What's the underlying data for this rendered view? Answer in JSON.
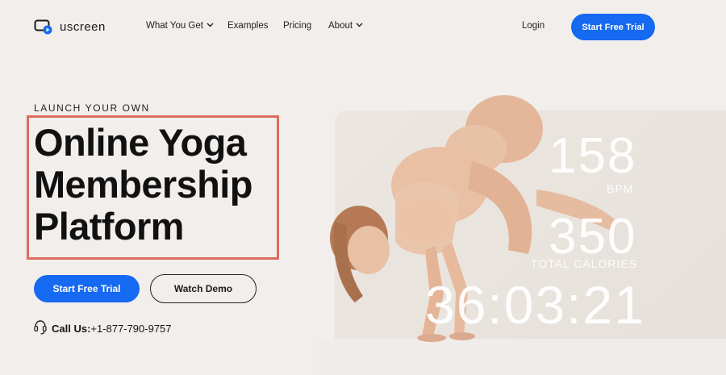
{
  "brand": {
    "name": "uscreen",
    "logo_icon": "play-screen-icon"
  },
  "nav": {
    "items": [
      {
        "label": "What You Get",
        "has_dropdown": true
      },
      {
        "label": "Examples",
        "has_dropdown": false
      },
      {
        "label": "Pricing",
        "has_dropdown": false
      },
      {
        "label": "About",
        "has_dropdown": true
      }
    ],
    "login_label": "Login",
    "cta_label": "Start Free Trial"
  },
  "hero": {
    "eyebrow": "LAUNCH YOUR OWN",
    "headline": [
      "Online Yoga",
      "Membership",
      "Platform"
    ],
    "primary_button": "Start Free Trial",
    "secondary_button": "Watch Demo",
    "call_label": "Call Us:",
    "call_number": "+1-877-790-9757",
    "call_icon": "headset-icon"
  },
  "stats": {
    "bpm_value": "158",
    "bpm_label": "BPM",
    "calories_value": "350",
    "calories_label": "TOTAL CALORIES",
    "timer_value": "36:03:21"
  },
  "colors": {
    "accent": "#1669f1",
    "highlight_border": "#dd6b5e",
    "background": "#f1eeeb"
  }
}
